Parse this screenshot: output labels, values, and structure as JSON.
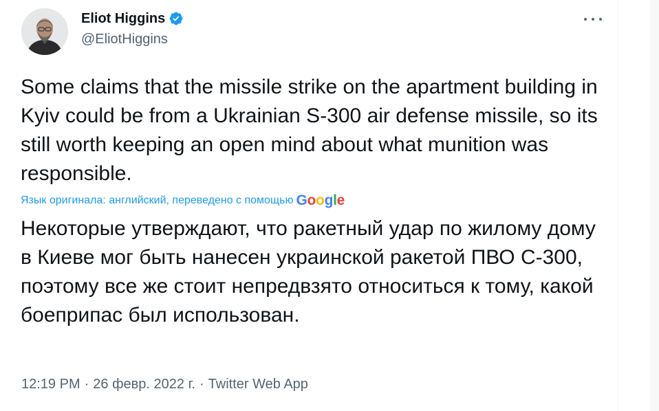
{
  "author": {
    "display_name": "Eliot Higgins",
    "handle": "@EliotHiggins"
  },
  "more_menu": {
    "icon": "more-horizontal-icon"
  },
  "tweet": {
    "text": "Some claims that the missile strike on the apartment building in Kyiv could be from a Ukrainian S-300 air defense missile, so its still worth keeping an open mind about what munition was responsible."
  },
  "translation": {
    "note": "Язык оригинала: английский, переведено с помощью",
    "provider_logo": "Google",
    "text": "Некоторые утверждают, что ракетный удар по жилому дому в Киеве мог быть нанесен украинской ракетой ПВО С-300, поэтому все же стоит непредвзято относиться к тому, какой боеприпас был использован."
  },
  "meta": {
    "time": "12:19 PM",
    "separator": "·",
    "date": "26 февр. 2022 г.",
    "source": "Twitter Web App"
  },
  "colors": {
    "text": "#0f1419",
    "secondary": "#536471",
    "link": "#1d9bf0",
    "verified": "#1d9bf0"
  }
}
